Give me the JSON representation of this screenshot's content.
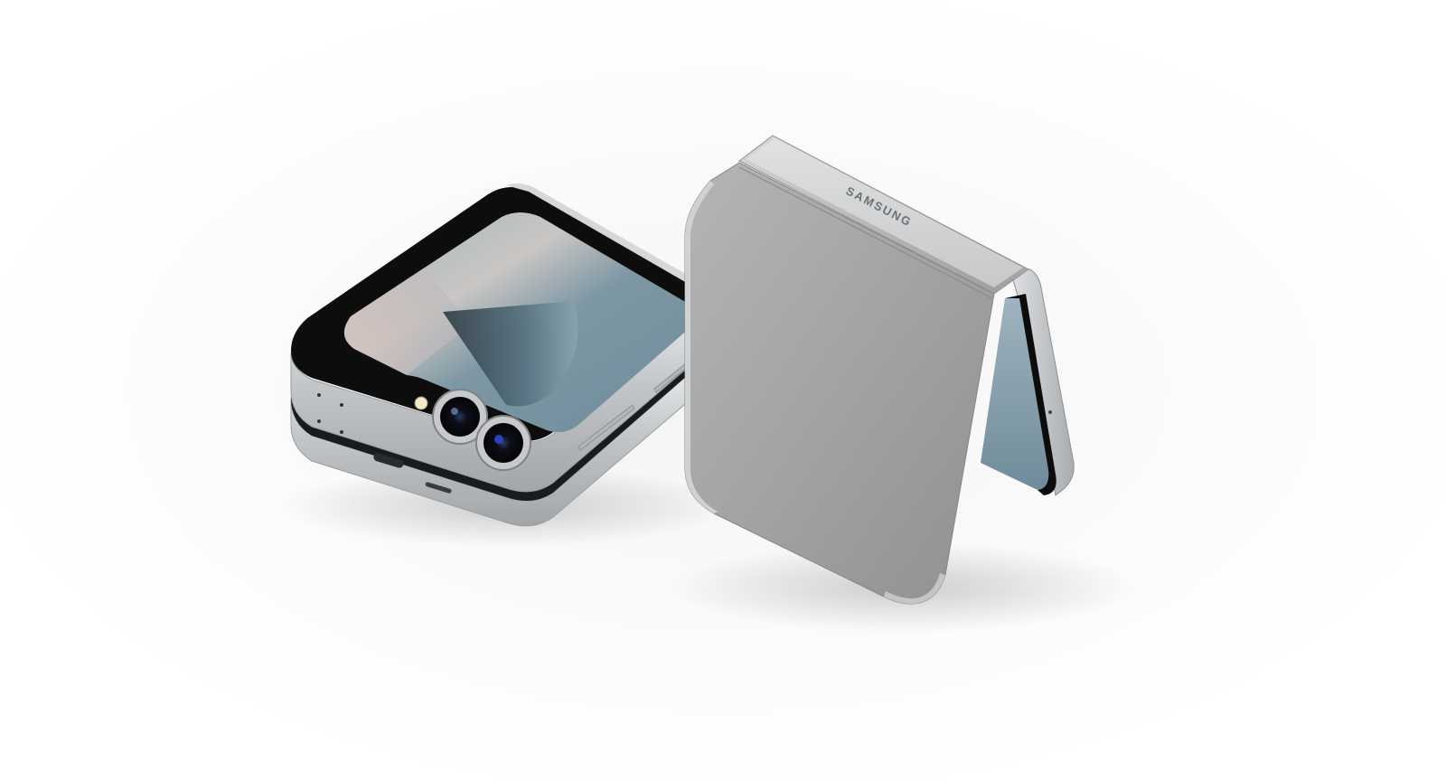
{
  "logo": {
    "brand_text": "SAMSUNG"
  },
  "colors": {
    "background": "#ffffff",
    "frame_silver": "#c9cbcd",
    "back_panel": "#a6a7a8",
    "screen_black": "#0b0b0c",
    "wallpaper_blue": "#7c9aa8"
  }
}
